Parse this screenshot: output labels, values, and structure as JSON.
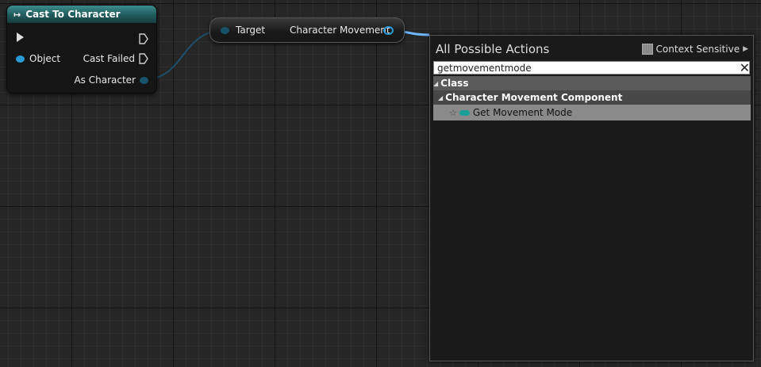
{
  "cast_node": {
    "title": "Cast To Character",
    "icon": "cast-arrow-icon",
    "object_label": "Object",
    "cast_failed_label": "Cast Failed",
    "as_character_label": "As Character"
  },
  "target_node": {
    "target_label": "Target",
    "output_label": "Character Movement"
  },
  "action_menu": {
    "title": "All Possible Actions",
    "context_sensitive_label": "Context Sensitive",
    "search_value": "getmovementmode",
    "clear_glyph": "✕",
    "tree": {
      "category": "Class",
      "subcategory": "Character Movement Component",
      "item": "Get Movement Mode"
    }
  },
  "colors": {
    "object_pin": "#2a9bd4",
    "wire": "#5fb6ff",
    "header_teal": "#3d8c8c",
    "function_icon": "#1ba098"
  }
}
